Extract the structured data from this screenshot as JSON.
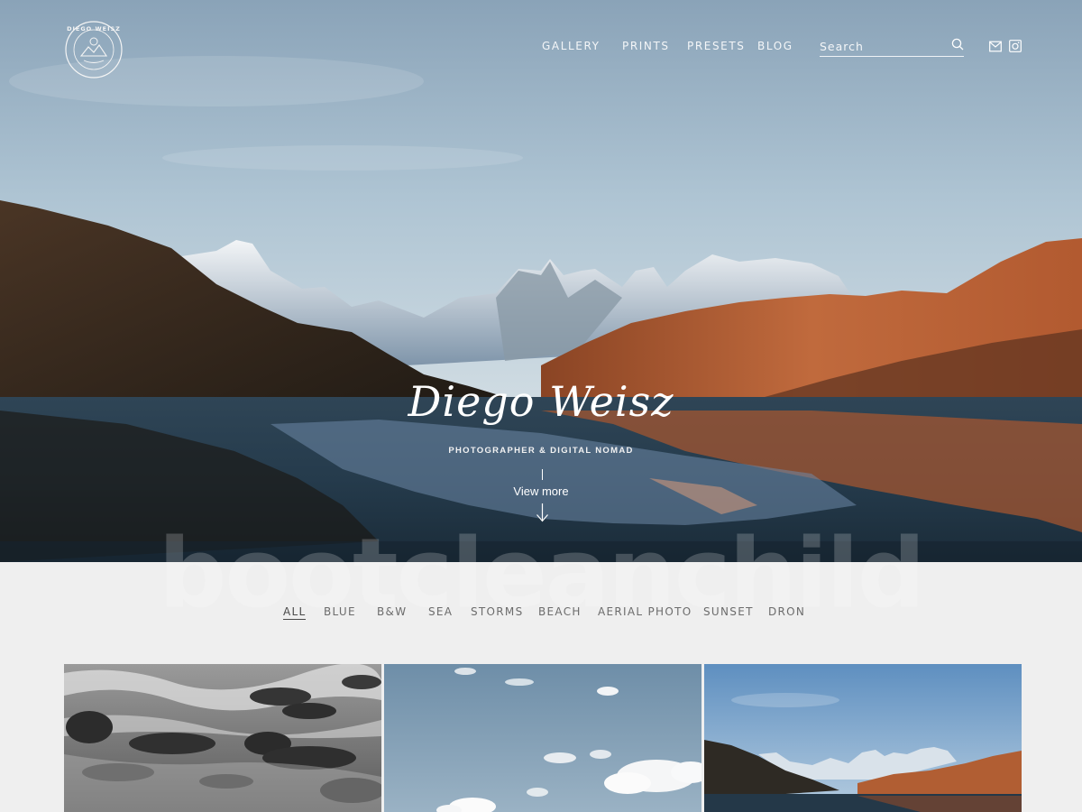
{
  "brand": {
    "logo_text": "DIEGO WEISZ",
    "logo_icon": "sun-mountain-badge-icon"
  },
  "nav": {
    "items": [
      "GALLERY",
      "PRINTS",
      "PRESETS",
      "BLOG"
    ]
  },
  "search": {
    "placeholder": "Search",
    "icon": "search-icon"
  },
  "social": {
    "mail_icon": "mail-icon",
    "instagram_icon": "instagram-icon"
  },
  "hero": {
    "title": "Diego Weisz",
    "subtitle": "PHOTOGRAPHER & DIGITAL NOMAD",
    "cta": "View more",
    "cta_icon": "arrow-down-icon"
  },
  "watermark": "bootcleanchild",
  "filters": {
    "active": "ALL",
    "items": [
      "ALL",
      "BLUE",
      "B&W",
      "SEA",
      "STORMS",
      "BEACH",
      "AERIAL PHOTO",
      "SUNSET",
      "DRON"
    ]
  },
  "gallery": {
    "items": [
      {
        "subject": "black-and-white rocky sea shore"
      },
      {
        "subject": "blue sky with clouds"
      },
      {
        "subject": "mountain lake at sunset"
      }
    ]
  },
  "colors": {
    "page_bg": "#efefef",
    "sky_top": "#a9bfd0",
    "sky_bottom": "#dfe6ea",
    "mountain_orange": "#b8643a",
    "lake_dark": "#1a2a38",
    "filter_text": "#6c6c6c"
  }
}
